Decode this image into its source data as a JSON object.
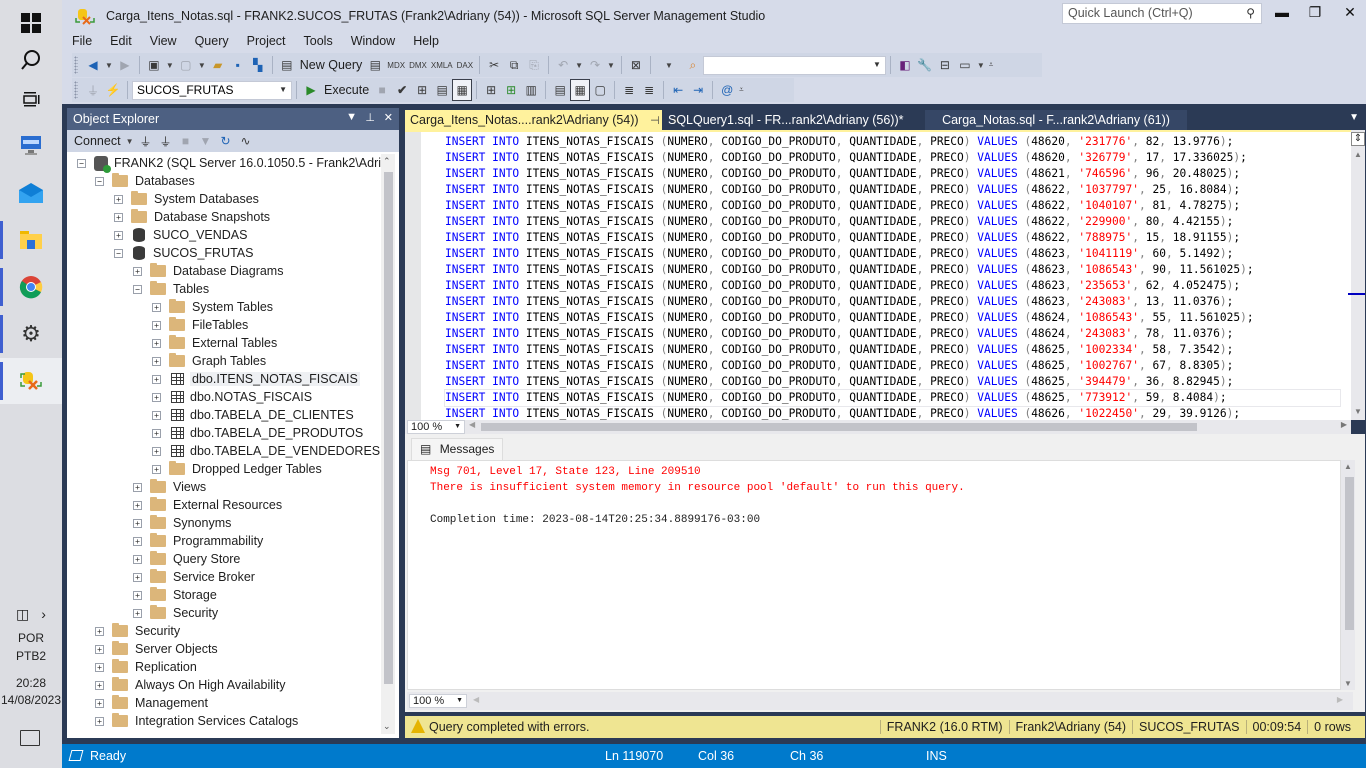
{
  "window": {
    "title": "Carga_Itens_Notas.sql - FRANK2.SUCOS_FRUTAS (Frank2\\Adriany (54)) - Microsoft SQL Server Management Studio",
    "quick_launch_placeholder": "Quick Launch (Ctrl+Q)"
  },
  "menu": [
    "File",
    "Edit",
    "View",
    "Query",
    "Project",
    "Tools",
    "Window",
    "Help"
  ],
  "toolbar": {
    "new_query_label": "New Query",
    "database_selected": "SUCOS_FRUTAS",
    "execute_label": "Execute",
    "search_combo_value": ""
  },
  "object_explorer": {
    "title": "Object Explorer",
    "connect_label": "Connect",
    "tree": [
      {
        "label": "FRANK2 (SQL Server 16.0.1050.5 - Frank2\\Adriany)",
        "level": 0,
        "icon": "server",
        "expanded": true
      },
      {
        "label": "Databases",
        "level": 1,
        "icon": "folder",
        "expanded": true
      },
      {
        "label": "System Databases",
        "level": 2,
        "icon": "folder",
        "expanded": false
      },
      {
        "label": "Database Snapshots",
        "level": 2,
        "icon": "folder",
        "expanded": false
      },
      {
        "label": "SUCO_VENDAS",
        "level": 2,
        "icon": "database",
        "expanded": false
      },
      {
        "label": "SUCOS_FRUTAS",
        "level": 2,
        "icon": "database",
        "expanded": true
      },
      {
        "label": "Database Diagrams",
        "level": 3,
        "icon": "folder",
        "expanded": false
      },
      {
        "label": "Tables",
        "level": 3,
        "icon": "folder",
        "expanded": true
      },
      {
        "label": "System Tables",
        "level": 4,
        "icon": "folder",
        "expanded": false
      },
      {
        "label": "FileTables",
        "level": 4,
        "icon": "folder",
        "expanded": false
      },
      {
        "label": "External Tables",
        "level": 4,
        "icon": "folder",
        "expanded": false
      },
      {
        "label": "Graph Tables",
        "level": 4,
        "icon": "folder",
        "expanded": false
      },
      {
        "label": "dbo.ITENS_NOTAS_FISCAIS",
        "level": 4,
        "icon": "table",
        "expanded": false,
        "highlighted": true
      },
      {
        "label": "dbo.NOTAS_FISCAIS",
        "level": 4,
        "icon": "table",
        "expanded": false
      },
      {
        "label": "dbo.TABELA_DE_CLIENTES",
        "level": 4,
        "icon": "table",
        "expanded": false
      },
      {
        "label": "dbo.TABELA_DE_PRODUTOS",
        "level": 4,
        "icon": "table",
        "expanded": false
      },
      {
        "label": "dbo.TABELA_DE_VENDEDORES",
        "level": 4,
        "icon": "table",
        "expanded": false
      },
      {
        "label": "Dropped Ledger Tables",
        "level": 4,
        "icon": "folder",
        "expanded": false
      },
      {
        "label": "Views",
        "level": 3,
        "icon": "folder",
        "expanded": false
      },
      {
        "label": "External Resources",
        "level": 3,
        "icon": "folder",
        "expanded": false
      },
      {
        "label": "Synonyms",
        "level": 3,
        "icon": "folder",
        "expanded": false
      },
      {
        "label": "Programmability",
        "level": 3,
        "icon": "folder",
        "expanded": false
      },
      {
        "label": "Query Store",
        "level": 3,
        "icon": "folder",
        "expanded": false
      },
      {
        "label": "Service Broker",
        "level": 3,
        "icon": "folder",
        "expanded": false
      },
      {
        "label": "Storage",
        "level": 3,
        "icon": "folder",
        "expanded": false
      },
      {
        "label": "Security",
        "level": 3,
        "icon": "folder",
        "expanded": false
      },
      {
        "label": "Security",
        "level": 1,
        "icon": "folder",
        "expanded": false
      },
      {
        "label": "Server Objects",
        "level": 1,
        "icon": "folder",
        "expanded": false
      },
      {
        "label": "Replication",
        "level": 1,
        "icon": "folder",
        "expanded": false
      },
      {
        "label": "Always On High Availability",
        "level": 1,
        "icon": "folder",
        "expanded": false
      },
      {
        "label": "Management",
        "level": 1,
        "icon": "folder",
        "expanded": false
      },
      {
        "label": "Integration Services Catalogs",
        "level": 1,
        "icon": "folder",
        "expanded": false
      }
    ]
  },
  "tabs": [
    {
      "label": "Carga_Itens_Notas....rank2\\Adriany (54))",
      "active": true
    },
    {
      "label": "SQLQuery1.sql - FR...rank2\\Adriany (56))*",
      "active": false
    },
    {
      "label": "Carga_Notas.sql - F...rank2\\Adriany (61))",
      "active": false
    }
  ],
  "editor": {
    "statement_prefix": [
      "INSERT",
      "INTO",
      "ITENS_NOTAS_FISCAIS",
      "NUMERO",
      "CODIGO_DO_PRODUTO",
      "QUANTIDADE",
      "PRECO",
      "VALUES"
    ],
    "rows": [
      {
        "numero": "48620",
        "codigo": "'231776'",
        "quantidade": "82",
        "preco": "13.9776"
      },
      {
        "numero": "48620",
        "codigo": "'326779'",
        "quantidade": "17",
        "preco": "17.336025"
      },
      {
        "numero": "48621",
        "codigo": "'746596'",
        "quantidade": "96",
        "preco": "20.48025"
      },
      {
        "numero": "48622",
        "codigo": "'1037797'",
        "quantidade": "25",
        "preco": "16.8084"
      },
      {
        "numero": "48622",
        "codigo": "'1040107'",
        "quantidade": "81",
        "preco": "4.78275"
      },
      {
        "numero": "48622",
        "codigo": "'229900'",
        "quantidade": "80",
        "preco": "4.42155"
      },
      {
        "numero": "48622",
        "codigo": "'788975'",
        "quantidade": "15",
        "preco": "18.91155"
      },
      {
        "numero": "48623",
        "codigo": "'1041119'",
        "quantidade": "60",
        "preco": "5.1492"
      },
      {
        "numero": "48623",
        "codigo": "'1086543'",
        "quantidade": "90",
        "preco": "11.561025"
      },
      {
        "numero": "48623",
        "codigo": "'235653'",
        "quantidade": "62",
        "preco": "4.052475"
      },
      {
        "numero": "48623",
        "codigo": "'243083'",
        "quantidade": "13",
        "preco": "11.0376"
      },
      {
        "numero": "48624",
        "codigo": "'1086543'",
        "quantidade": "55",
        "preco": "11.561025"
      },
      {
        "numero": "48624",
        "codigo": "'243083'",
        "quantidade": "78",
        "preco": "11.0376"
      },
      {
        "numero": "48625",
        "codigo": "'1002334'",
        "quantidade": "58",
        "preco": "7.3542"
      },
      {
        "numero": "48625",
        "codigo": "'1002767'",
        "quantidade": "67",
        "preco": "8.8305"
      },
      {
        "numero": "48625",
        "codigo": "'394479'",
        "quantidade": "36",
        "preco": "8.82945"
      },
      {
        "numero": "48625",
        "codigo": "'773912'",
        "quantidade": "59",
        "preco": "8.4084",
        "current": true
      },
      {
        "numero": "48626",
        "codigo": "'1022450'",
        "quantidade": "29",
        "preco": "39.9126"
      }
    ],
    "zoom": "100 %"
  },
  "results": {
    "tab_label": "Messages",
    "lines": [
      {
        "text": "Msg 701, Level 17, State 123, Line 209510",
        "type": "error"
      },
      {
        "text": "There is insufficient system memory in resource pool 'default' to run this query.",
        "type": "error"
      },
      {
        "text": "",
        "type": "normal"
      },
      {
        "text": "Completion time: 2023-08-14T20:25:34.8899176-03:00",
        "type": "normal"
      }
    ],
    "zoom": "100 %"
  },
  "query_status": {
    "message": "Query completed with errors.",
    "server": "FRANK2 (16.0 RTM)",
    "user": "Frank2\\Adriany (54)",
    "database": "SUCOS_FRUTAS",
    "elapsed": "00:09:54",
    "rows": "0 rows"
  },
  "statusbar": {
    "state": "Ready",
    "line": "Ln 119070",
    "col": "Col 36",
    "ch": "Ch 36",
    "mode": "INS"
  },
  "system_tray": {
    "lang1": "POR",
    "lang2": "PTB2",
    "time": "20:28",
    "date": "14/08/2023"
  },
  "colors": {
    "keyword": "#0000ff",
    "string": "#ff0000",
    "active_tab": "#fff29d",
    "statusbar": "#007acc",
    "query_status_bg": "#efe592"
  }
}
